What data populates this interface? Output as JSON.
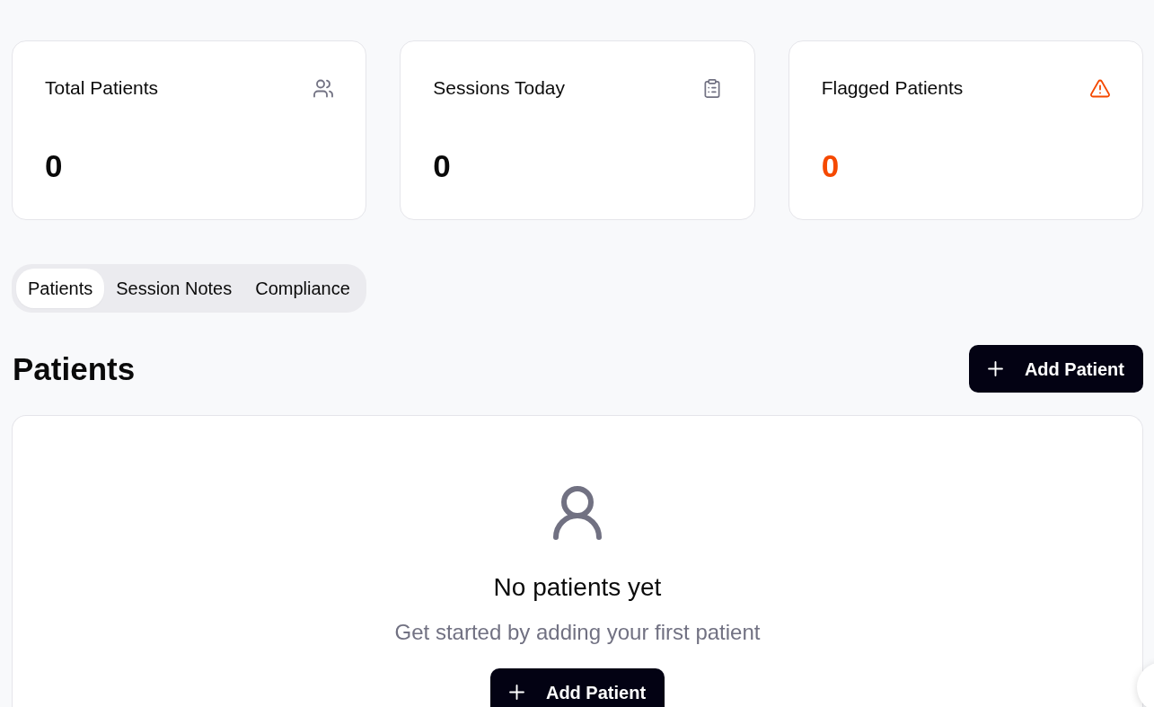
{
  "stat_cards": [
    {
      "kind": "patients",
      "title": "Total Patients",
      "value": "0"
    },
    {
      "kind": "sessions",
      "title": "Sessions Today",
      "value": "0"
    },
    {
      "kind": "flagged",
      "title": "Flagged Patients",
      "value": "0"
    }
  ],
  "tabs": [
    {
      "label": "Patients",
      "selected": true
    },
    {
      "label": "Session Notes",
      "selected": false
    },
    {
      "label": "Compliance",
      "selected": false
    }
  ],
  "section": {
    "title": "Patients",
    "add_button": {
      "label": "Add Patient"
    }
  },
  "empty_state": {
    "title": "No patients yet",
    "message": "Get started by adding your first patient",
    "button": {
      "label": "Add Patient"
    }
  }
}
